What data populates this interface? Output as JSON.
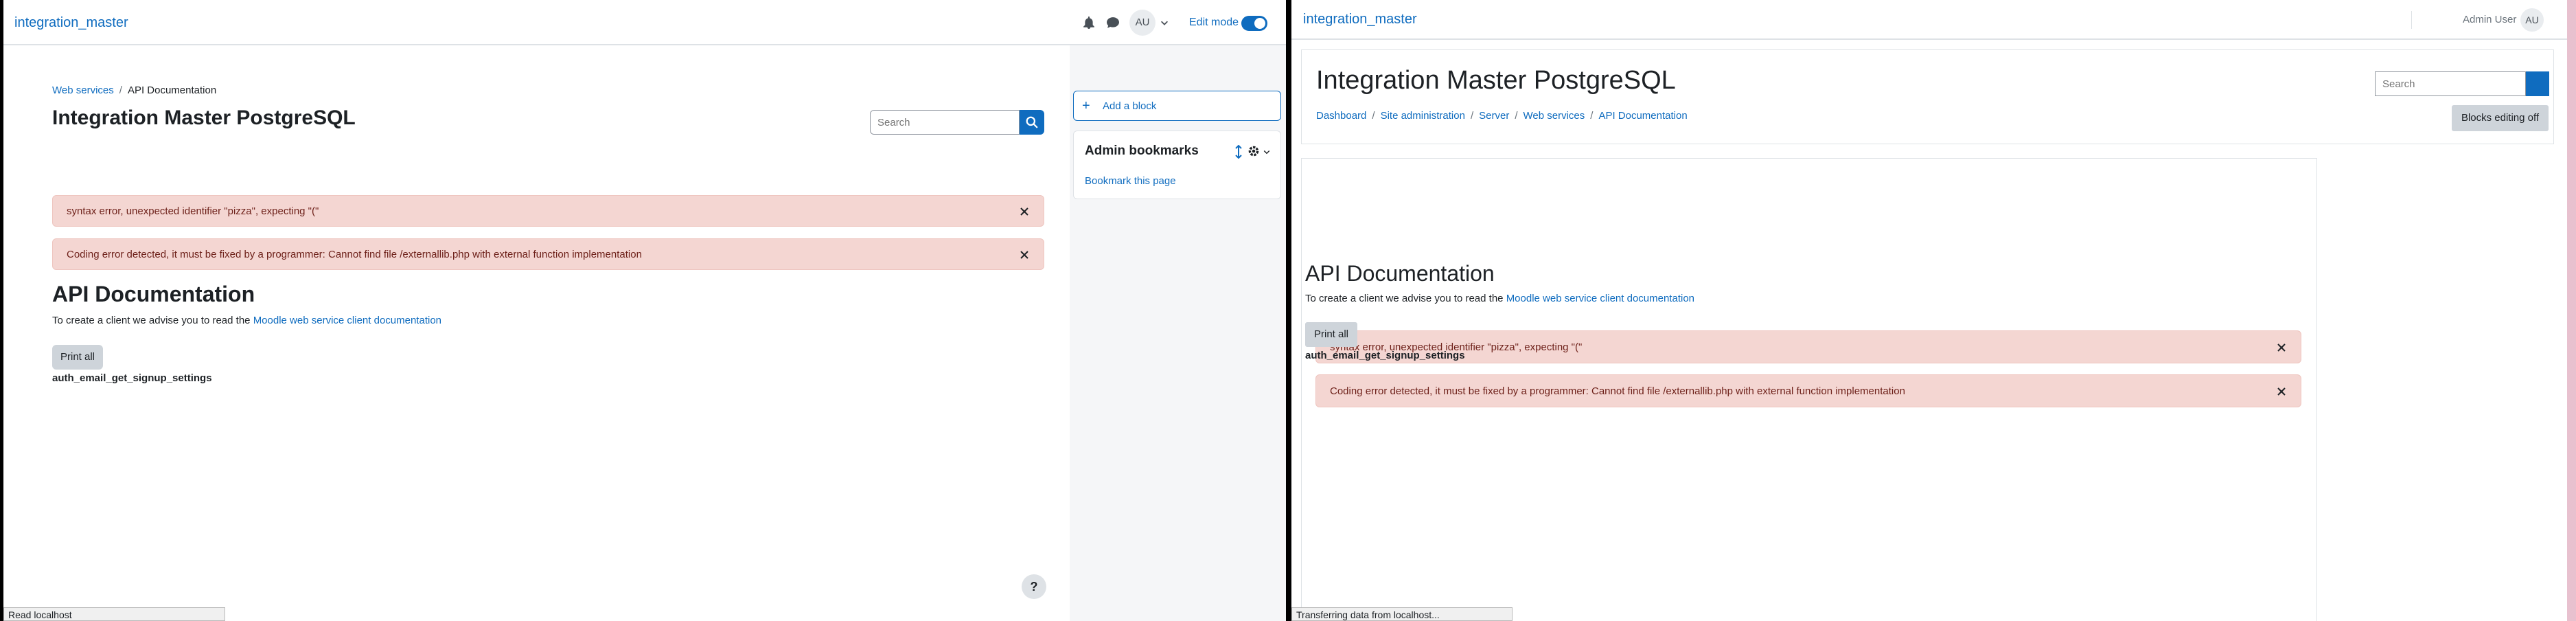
{
  "left": {
    "brand": "integration_master",
    "avatar_initials": "AU",
    "edit_mode_label": "Edit mode",
    "breadcrumb": [
      "Web services",
      "API Documentation"
    ],
    "page_title": "Integration Master PostgreSQL",
    "search_placeholder": "Search",
    "alerts": [
      "syntax error, unexpected identifier \"pizza\", expecting \"(\"",
      "Coding error detected, it must be fixed by a programmer: Cannot find file /externallib.php with external function implementation"
    ],
    "section_title": "API Documentation",
    "intro_text": "To create a client we advise you to read the",
    "intro_link": "Moodle web service client documentation",
    "print_button": "Print all",
    "function_name": "auth_email_get_signup_settings",
    "drawer": {
      "add_block": "Add a block",
      "bookmarks_title": "Admin bookmarks",
      "bookmark_link": "Bookmark this page"
    },
    "help_label": "?",
    "status_text": "Read localhost"
  },
  "right": {
    "brand": "integration_master",
    "user_name": "Admin User",
    "avatar_initials": "AU",
    "page_title": "Integration Master PostgreSQL",
    "search_placeholder": "Search",
    "breadcrumb": [
      "Dashboard",
      "Site administration",
      "Server",
      "Web services",
      "API Documentation"
    ],
    "blocks_button": "Blocks editing off",
    "alerts": [
      "syntax error, unexpected identifier \"pizza\", expecting \"(\"",
      "Coding error detected, it must be fixed by a programmer: Cannot find file /externallib.php with external function implementation"
    ],
    "section_title": "API Documentation",
    "intro_text": "To create a client we advise you to read the",
    "intro_link": "Moodle web service client documentation",
    "print_button": "Print all",
    "function_name": "auth_email_get_signup_settings",
    "status_text": "Transferring data from localhost..."
  },
  "colors": {
    "accent": "#0f6cbf",
    "alert_bg": "#f4d6d2",
    "alert_text": "#6e211a",
    "button_secondary": "#ced4da"
  },
  "icons": [
    "bell-icon",
    "chat-icon",
    "chevron-down-icon",
    "search-icon",
    "close-icon",
    "plus-icon",
    "move-icon",
    "gear-icon",
    "help-icon"
  ]
}
